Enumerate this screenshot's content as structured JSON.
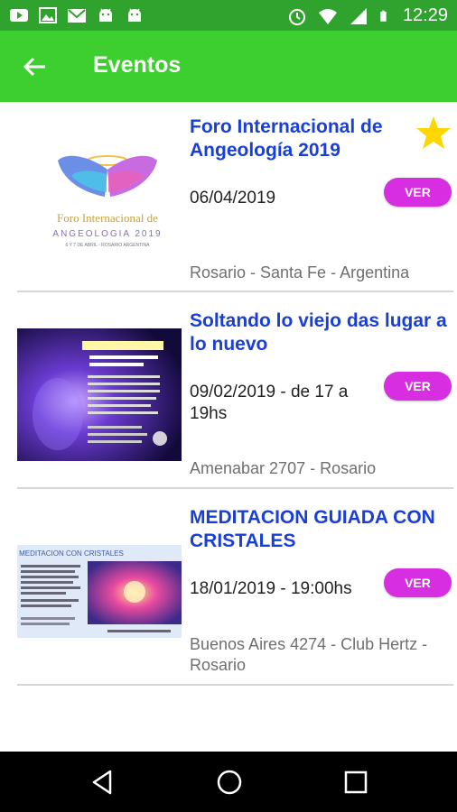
{
  "status_bar": {
    "time": "12:29",
    "left_icons": [
      "youtube-icon",
      "gallery-icon",
      "gmail-icon",
      "android-icon",
      "android-icon"
    ],
    "right_icons": [
      "alarm-icon",
      "wifi-icon",
      "signal-icon",
      "battery-icon"
    ]
  },
  "app_bar": {
    "title": "Eventos",
    "back_icon": "arrow-left-icon",
    "color": "#3dce2f"
  },
  "events": [
    {
      "title": "Foro Internacional de Angeología 2019",
      "date": "06/04/2019",
      "place": "Rosario - Santa Fe - Argentina",
      "button": "VER",
      "favorite": true,
      "thumb_text": [
        "Foro Internacional de",
        "ANGEOLOGIA 2019",
        "6 Y 7 DE ABRIL - ROSARIO ARGENTINA"
      ]
    },
    {
      "title": "Soltando lo viejo das lugar a lo nuevo",
      "date": "09/02/2019 - de 17 a 19hs",
      "place": "Amenabar 2707 - Rosario",
      "button": "VER",
      "favorite": false
    },
    {
      "title": "MEDITACION GUIADA CON CRISTALES",
      "date": "18/01/2019 - 19:00hs",
      "place": "Buenos Aires 4274 - Club Hertz - Rosario",
      "button": "VER",
      "favorite": false,
      "thumb_text": [
        "MEDITACION CON CRISTALES"
      ]
    }
  ],
  "colors": {
    "status_bar": "#30a32f",
    "title_blue": "#1a3fd6",
    "button_magenta": "#d62ee0",
    "star": "#ffd600"
  },
  "nav_bar": [
    "back-triangle-icon",
    "home-circle-icon",
    "recents-square-icon"
  ]
}
